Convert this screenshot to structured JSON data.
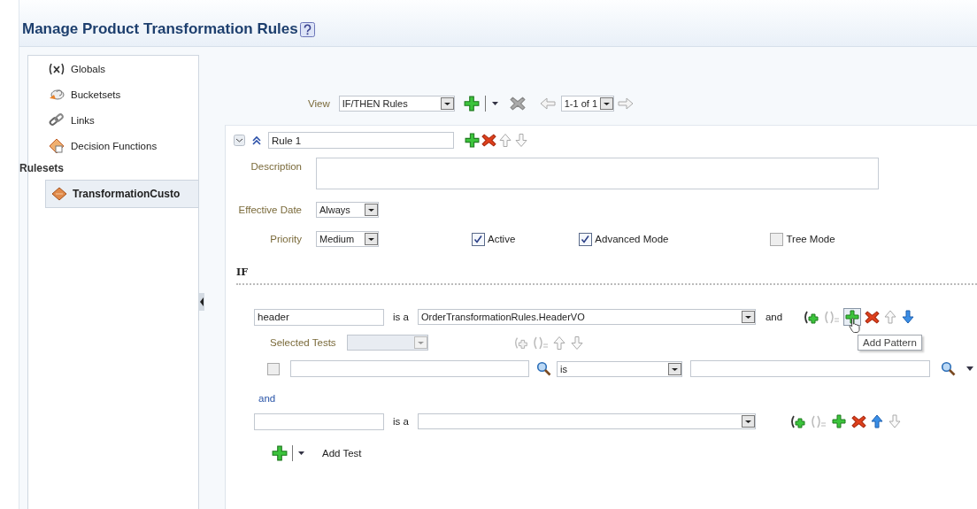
{
  "header": {
    "title": "Manage Product Transformation Rules"
  },
  "sidebar": {
    "items": [
      {
        "label": "Globals",
        "kind": "variable"
      },
      {
        "label": "Bucketsets",
        "kind": "bucket"
      },
      {
        "label": "Links",
        "kind": "link"
      },
      {
        "label": "Decision Functions",
        "kind": "function"
      }
    ],
    "rulesets_heading": "Rulesets",
    "rulesets": [
      {
        "label": "TransformationCusto",
        "selected": true
      }
    ]
  },
  "toolbar": {
    "view_label": "View",
    "view_value": "IF/THEN Rules",
    "pager": "1-1 of 1"
  },
  "rule": {
    "name": "Rule 1",
    "description_label": "Description",
    "effective_date_label": "Effective Date",
    "effective_date": "Always",
    "priority_label": "Priority",
    "priority": "Medium",
    "options": [
      {
        "label": "Active",
        "checked": true
      },
      {
        "label": "Advanced Mode",
        "checked": true
      },
      {
        "label": "Tree Mode",
        "checked": false
      }
    ]
  },
  "if_heading": "IF",
  "patterns": [
    {
      "variable": "header",
      "is_a": "is a",
      "fact": "OrderTransformationRules.HeaderVO",
      "connector": "and",
      "up_disabled": true,
      "down_disabled": false,
      "hovered_add": true,
      "tooltip": "Add Pattern"
    },
    {
      "is_a": "is a",
      "up_disabled": false,
      "down_disabled": true,
      "hovered_add": false
    }
  ],
  "selected_tests": {
    "label": "Selected Tests",
    "test": {
      "checked": false,
      "operator": "is"
    }
  },
  "and_link": "and",
  "add_test": "Add Test"
}
